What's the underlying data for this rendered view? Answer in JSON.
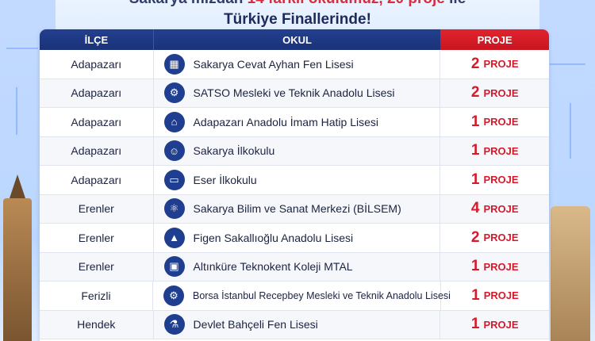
{
  "heading": {
    "line1_start": "Sakarya mızdan ",
    "line1_red1": "14 farklı okulumuz, 20 proje",
    "line1_end": " ile",
    "line2": "Türkiye Finallerinde!"
  },
  "table": {
    "headers": {
      "ilce": "İLÇE",
      "okul": "OKUL",
      "proje": "PROJE"
    },
    "rows": [
      {
        "ilce": "Adapazarı",
        "okul": "Sakarya Cevat Ayhan Fen Lisesi",
        "icon": "building-icon",
        "glyph": "▦",
        "proje_num": "2",
        "proje_unit": "PROJE"
      },
      {
        "ilce": "Adapazarı",
        "okul": "SATSO Mesleki ve Teknik Anadolu Lisesi",
        "icon": "gear-icon",
        "glyph": "⚙",
        "proje_num": "2",
        "proje_unit": "PROJE"
      },
      {
        "ilce": "Adapazarı",
        "okul": "Adapazarı Anadolu İmam Hatip Lisesi",
        "icon": "mosque-icon",
        "glyph": "⌂",
        "proje_num": "1",
        "proje_unit": "PROJE"
      },
      {
        "ilce": "Adapazarı",
        "okul": "Sakarya İlkokulu",
        "icon": "children-icon",
        "glyph": "☺",
        "proje_num": "1",
        "proje_unit": "PROJE"
      },
      {
        "ilce": "Adapazarı",
        "okul": "Eser İlkokulu",
        "icon": "book-icon",
        "glyph": "▭",
        "proje_num": "1",
        "proje_unit": "PROJE"
      },
      {
        "ilce": "Erenler",
        "okul": "Sakarya Bilim ve Sanat Merkezi (BİLSEM)",
        "icon": "atom-icon",
        "glyph": "⚛",
        "proje_num": "4",
        "proje_unit": "PROJE"
      },
      {
        "ilce": "Erenler",
        "okul": "Figen Sakallıoğlu Anadolu Lisesi",
        "icon": "graduation-cap-icon",
        "glyph": "▲",
        "proje_num": "2",
        "proje_unit": "PROJE"
      },
      {
        "ilce": "Erenler",
        "okul": "Altınküre Teknokent Koleji MTAL",
        "icon": "chip-icon",
        "glyph": "▣",
        "proje_num": "1",
        "proje_unit": "PROJE"
      },
      {
        "ilce": "Ferizli",
        "okul": "Borsa İstanbul Recepbey Mesleki ve Teknik Anadolu Lisesi",
        "icon": "gear-icon",
        "glyph": "⚙",
        "proje_num": "1",
        "proje_unit": "PROJE",
        "small": true
      },
      {
        "ilce": "Hendek",
        "okul": "Devlet Bahçeli Fen Lisesi",
        "icon": "flask-icon",
        "glyph": "⚗",
        "proje_num": "1",
        "proje_unit": "PROJE"
      }
    ]
  }
}
